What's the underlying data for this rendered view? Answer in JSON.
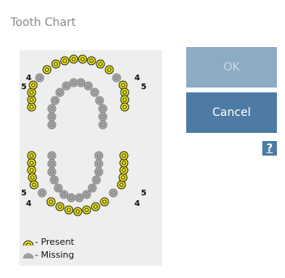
{
  "dialog": {
    "title": "Tooth Chart"
  },
  "buttons": {
    "ok_label": "OK",
    "cancel_label": "Cancel",
    "help_label": "?"
  },
  "chart": {
    "labels": {
      "upper_left_4": "4",
      "upper_left_5": "5",
      "upper_right_4": "4",
      "upper_right_5": "5",
      "lower_left_5": "5",
      "lower_left_4": "4",
      "lower_right_5": "5",
      "lower_right_4": "4"
    },
    "legend": {
      "present": "- Present",
      "missing": "- Missing"
    },
    "colors": {
      "present_fill": "#f4ec1c",
      "present_outline": "#2a2a1a",
      "missing_fill": "#a9a9a9",
      "missing_outline": "#8a8a8a"
    }
  }
}
